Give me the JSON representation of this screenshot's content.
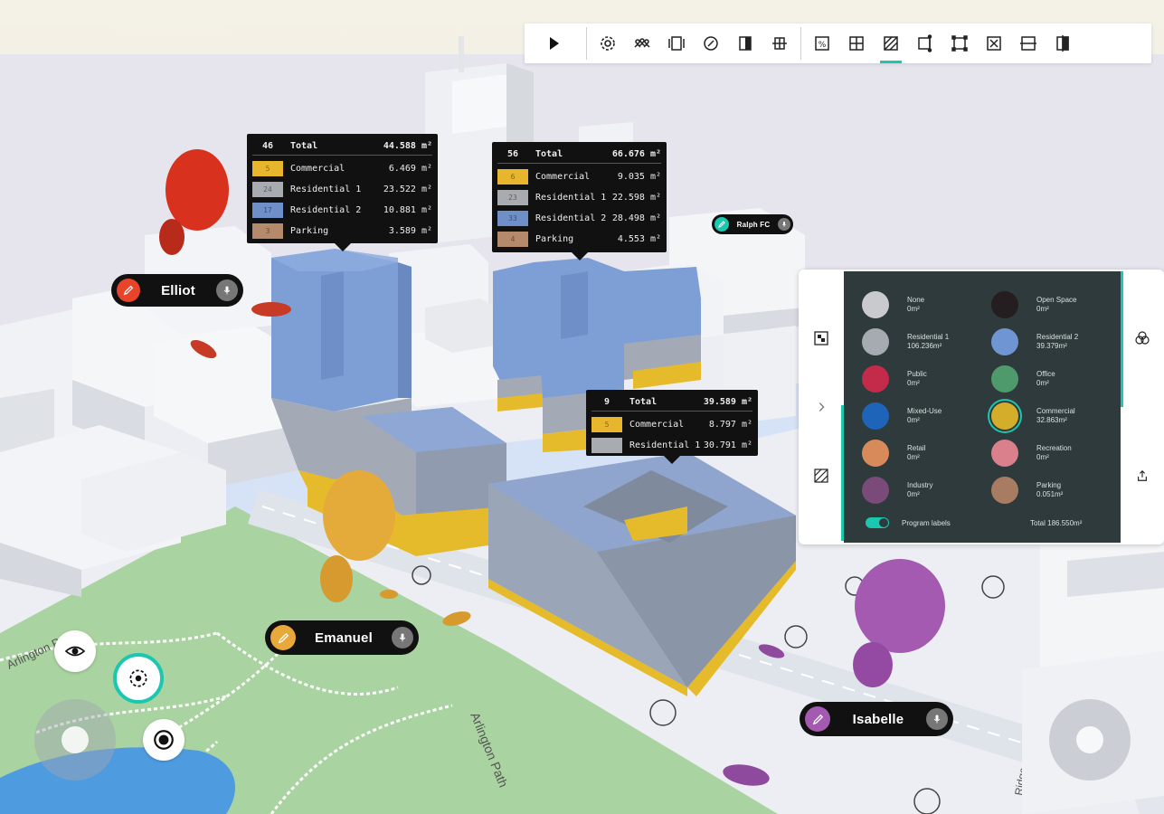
{
  "toolbar": {
    "buttons": [
      {
        "icon": "play-icon"
      },
      {
        "icon": "settings-icon"
      },
      {
        "icon": "people-icon"
      },
      {
        "icon": "split-view-icon"
      },
      {
        "icon": "compass-icon"
      },
      {
        "icon": "contrast-icon"
      },
      {
        "icon": "align-icon"
      },
      {
        "icon": "percent-box-icon"
      },
      {
        "icon": "grid-icon"
      },
      {
        "icon": "hatch-icon",
        "active": true
      },
      {
        "icon": "move-edge-icon"
      },
      {
        "icon": "select-box-icon"
      },
      {
        "icon": "close-box-icon"
      },
      {
        "icon": "split-horizontal-icon"
      },
      {
        "icon": "split-vertical-icon"
      }
    ],
    "accent": "#1cc7b0"
  },
  "program_labels": [
    {
      "count": "46",
      "total_label": "Total",
      "total": "44.588 m²",
      "rows": [
        {
          "code": "5",
          "name": "Commercial",
          "value": "6.469 m²",
          "color": "#e8b62c"
        },
        {
          "code": "24",
          "name": "Residential 1",
          "value": "23.522 m²",
          "color": "#a8abaf"
        },
        {
          "code": "17",
          "name": "Residential 2",
          "value": "10.881 m²",
          "color": "#6e8fc8"
        },
        {
          "code": "3",
          "name": "Parking",
          "value": "3.589 m²",
          "color": "#b48a6a"
        }
      ]
    },
    {
      "count": "56",
      "total_label": "Total",
      "total": "66.676 m²",
      "rows": [
        {
          "code": "6",
          "name": "Commercial",
          "value": "9.035 m²",
          "color": "#e8b62c"
        },
        {
          "code": "23",
          "name": "Residential 1",
          "value": "22.598 m²",
          "color": "#a8abaf"
        },
        {
          "code": "33",
          "name": "Residential 2",
          "value": "28.498 m²",
          "color": "#6e8fc8"
        },
        {
          "code": "4",
          "name": "Parking",
          "value": "4.553 m²",
          "color": "#b48a6a"
        }
      ]
    },
    {
      "count": "9",
      "total_label": "Total",
      "total": "39.589 m²",
      "rows": [
        {
          "code": "5",
          "name": "Commercial",
          "value": "8.797 m²",
          "color": "#e8b62c"
        },
        {
          "code": "",
          "name": "Residential 1",
          "value": "30.791 m²",
          "color": "#a8abaf"
        }
      ]
    }
  ],
  "users": [
    {
      "name": "Elliot",
      "color": "#e8442a"
    },
    {
      "name": "Emanuel",
      "color": "#e8a93a"
    },
    {
      "name": "Isabelle",
      "color": "#a35ab0"
    },
    {
      "name": "Ralph FC",
      "color": "#1cc7b0"
    }
  ],
  "legend": {
    "items": [
      {
        "name": "None",
        "value": "0m²",
        "color": "#c9cacd"
      },
      {
        "name": "Open Space",
        "value": "0m²",
        "color": "#241e20"
      },
      {
        "name": "Residential 1",
        "value": "106.236m²",
        "color": "#a6abb1"
      },
      {
        "name": "Residential 2",
        "value": "39.379m²",
        "color": "#6f95d2"
      },
      {
        "name": "Public",
        "value": "0m²",
        "color": "#c42a4a"
      },
      {
        "name": "Office",
        "value": "0m²",
        "color": "#4e9a6c"
      },
      {
        "name": "Mixed-Use",
        "value": "0m²",
        "color": "#1e64b8"
      },
      {
        "name": "Commercial",
        "value": "32.863m²",
        "color": "#d4ad2a",
        "selected": true
      },
      {
        "name": "Retail",
        "value": "0m²",
        "color": "#d98a5a"
      },
      {
        "name": "Recreation",
        "value": "0m²",
        "color": "#d9808c"
      },
      {
        "name": "Industry",
        "value": "0m²",
        "color": "#7a4a78"
      },
      {
        "name": "Parking",
        "value": "0.051m²",
        "color": "#a87c62"
      }
    ],
    "toggle_label": "Program labels",
    "toggle_on": true,
    "total": "Total 186.550m²"
  },
  "map_labels": {
    "street1": "Arlington Path",
    "street2": "Arlington Path",
    "street3": "Ridge"
  }
}
